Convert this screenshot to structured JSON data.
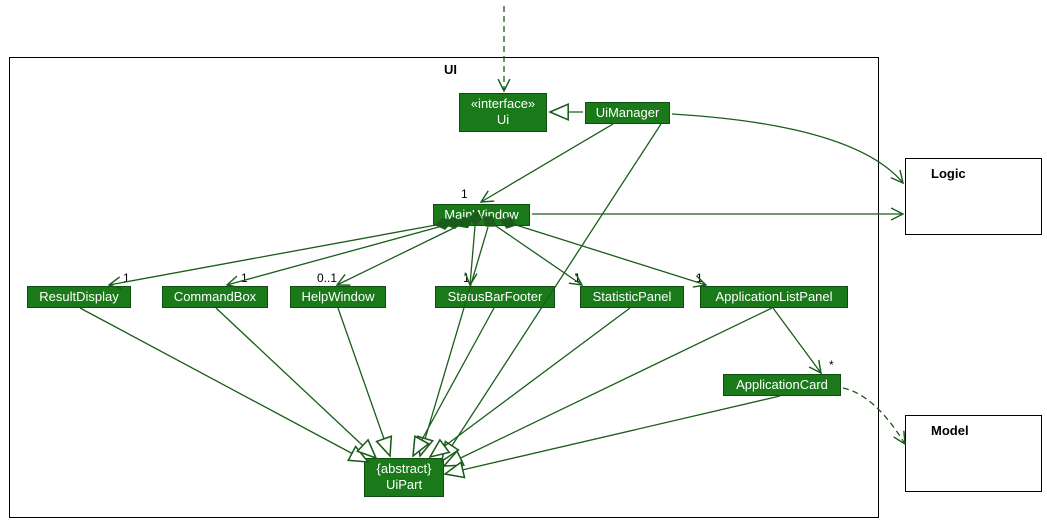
{
  "packages": {
    "ui": {
      "label": "UI"
    },
    "logic": {
      "label": "Logic"
    },
    "model": {
      "label": "Model"
    }
  },
  "classes": {
    "ui_interface": {
      "stereotype": "«interface»",
      "name": "Ui"
    },
    "ui_manager": {
      "name": "UiManager"
    },
    "main_window": {
      "name": "MainWindow"
    },
    "result_display": {
      "name": "ResultDisplay"
    },
    "command_box": {
      "name": "CommandBox"
    },
    "help_window": {
      "name": "HelpWindow"
    },
    "status_bar_footer": {
      "name": "StatusBarFooter"
    },
    "statistic_panel": {
      "name": "StatisticPanel"
    },
    "application_list_panel": {
      "name": "ApplicationListPanel"
    },
    "application_card": {
      "name": "ApplicationCard"
    },
    "ui_part": {
      "stereotype": "{abstract}",
      "name": "UiPart"
    }
  },
  "multiplicities": {
    "main_window": "1",
    "result_display": "1",
    "command_box": "1",
    "help_window": "0..1",
    "status_bar_footer": "1",
    "statistic_panel": "1",
    "application_list_panel": "1",
    "application_card": "*"
  },
  "chart_data": {
    "type": "uml_class_diagram",
    "packages": [
      "UI",
      "Logic",
      "Model"
    ],
    "classes_in_ui_package": [
      "«interface» Ui",
      "UiManager",
      "MainWindow",
      "ResultDisplay",
      "CommandBox",
      "HelpWindow",
      "StatusBarFooter",
      "StatisticPanel",
      "ApplicationListPanel",
      "ApplicationCard",
      "{abstract} UiPart"
    ],
    "external_packages": [
      "Logic",
      "Model"
    ],
    "relationships": [
      {
        "from": "(external)",
        "to": "Ui",
        "type": "dependency_dashed_arrow"
      },
      {
        "from": "UiManager",
        "to": "Ui",
        "type": "realization_hollow_triangle"
      },
      {
        "from": "UiManager",
        "to": "MainWindow",
        "type": "association_arrow",
        "multiplicity_to": "1"
      },
      {
        "from": "UiManager",
        "to": "Logic",
        "type": "association_arrow"
      },
      {
        "from": "MainWindow",
        "to": "Logic",
        "type": "association_arrow"
      },
      {
        "from": "MainWindow",
        "to": "ResultDisplay",
        "type": "composition_filled_diamond",
        "multiplicity_to": "1"
      },
      {
        "from": "MainWindow",
        "to": "CommandBox",
        "type": "composition_filled_diamond",
        "multiplicity_to": "1"
      },
      {
        "from": "MainWindow",
        "to": "HelpWindow",
        "type": "composition_filled_diamond",
        "multiplicity_to": "0..1"
      },
      {
        "from": "MainWindow",
        "to": "StatusBarFooter",
        "type": "composition_filled_diamond",
        "multiplicity_to": "1"
      },
      {
        "from": "MainWindow",
        "to": "StatisticPanel",
        "type": "composition_filled_diamond",
        "multiplicity_to": "1"
      },
      {
        "from": "MainWindow",
        "to": "ApplicationListPanel",
        "type": "composition_filled_diamond",
        "multiplicity_to": "1"
      },
      {
        "from": "ApplicationListPanel",
        "to": "ApplicationCard",
        "type": "association_arrow",
        "multiplicity_to": "*"
      },
      {
        "from": "ApplicationCard",
        "to": "Model",
        "type": "dependency_dashed_arrow"
      },
      {
        "from": "UiManager",
        "to": "UiPart",
        "type": "generalization_hollow_triangle"
      },
      {
        "from": "MainWindow",
        "to": "UiPart",
        "type": "generalization_hollow_triangle"
      },
      {
        "from": "ResultDisplay",
        "to": "UiPart",
        "type": "generalization_hollow_triangle"
      },
      {
        "from": "CommandBox",
        "to": "UiPart",
        "type": "generalization_hollow_triangle"
      },
      {
        "from": "HelpWindow",
        "to": "UiPart",
        "type": "generalization_hollow_triangle"
      },
      {
        "from": "StatusBarFooter",
        "to": "UiPart",
        "type": "generalization_hollow_triangle"
      },
      {
        "from": "StatisticPanel",
        "to": "UiPart",
        "type": "generalization_hollow_triangle"
      },
      {
        "from": "ApplicationListPanel",
        "to": "UiPart",
        "type": "generalization_hollow_triangle"
      },
      {
        "from": "ApplicationCard",
        "to": "UiPart",
        "type": "generalization_hollow_triangle"
      }
    ]
  }
}
